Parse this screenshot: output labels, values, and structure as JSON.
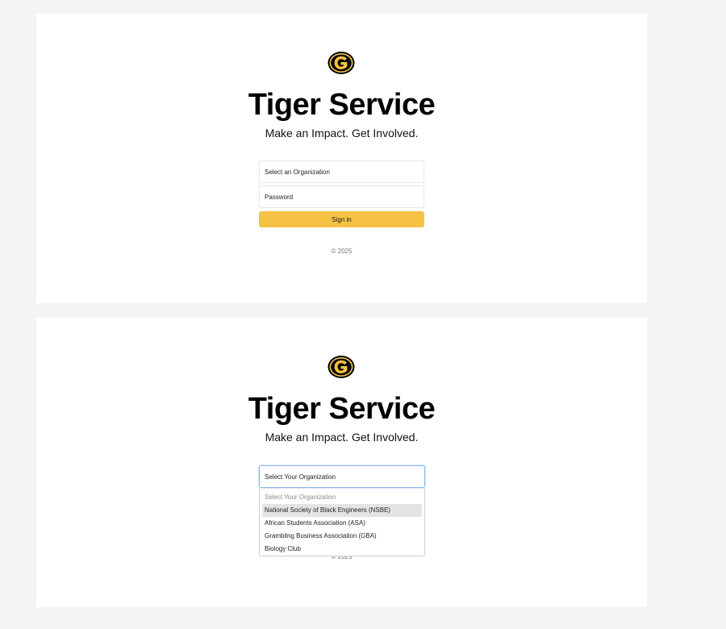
{
  "brand": {
    "title": "Tiger Service",
    "tagline": "Make an Impact. Get Involved.",
    "logo_icon": "grambling-g-logo-icon",
    "colors": {
      "gold": "#f6c243",
      "black": "#000000"
    }
  },
  "login_form": {
    "organization_select": {
      "label": "Select an Organization"
    },
    "password_field": {
      "placeholder": "Password"
    },
    "sign_in_label": "Sign in",
    "copyright": "© 2025"
  },
  "dropdown_view": {
    "selected_value": "Select Your Organization",
    "copyright": "© 2025",
    "options": [
      {
        "label": "Select Your Organization",
        "disabled": true
      },
      {
        "label": "National Society of Black Engineers (NSBE)",
        "highlighted": true
      },
      {
        "label": "African Students Association (ASA)"
      },
      {
        "label": "Grambling Business Association (GBA)"
      },
      {
        "label": "Biology Club"
      }
    ]
  }
}
